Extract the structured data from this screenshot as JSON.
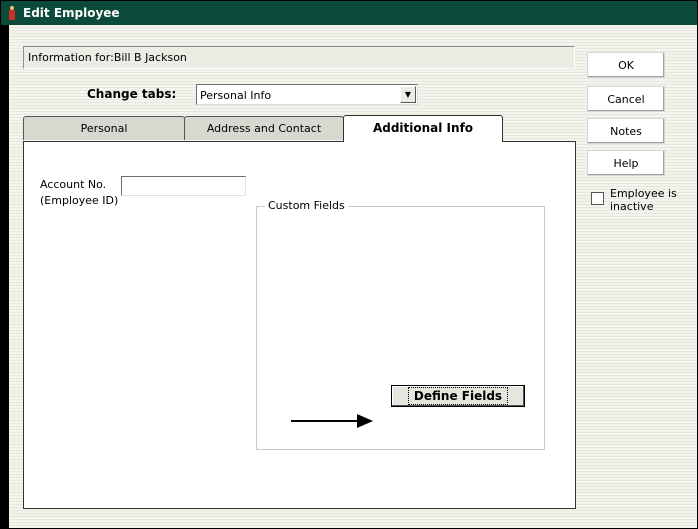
{
  "window": {
    "title": "Edit Employee"
  },
  "info": {
    "label": "Information for:",
    "employee_name": "Bill B Jackson"
  },
  "change_tabs": {
    "label": "Change tabs:",
    "selected": "Personal Info"
  },
  "tabs": [
    {
      "label": "Personal"
    },
    {
      "label": "Address and Contact"
    },
    {
      "label": "Additional Info"
    }
  ],
  "additional_info": {
    "account_no_label": "Account No.",
    "account_no_value": "",
    "employee_id_label": "(Employee ID)",
    "custom_fields_legend": "Custom Fields",
    "define_fields_label": "Define Fields"
  },
  "side_buttons": {
    "ok": "OK",
    "cancel": "Cancel",
    "notes": "Notes",
    "help": "Help"
  },
  "inactive_checkbox": {
    "label": "Employee is inactive",
    "checked": false
  }
}
